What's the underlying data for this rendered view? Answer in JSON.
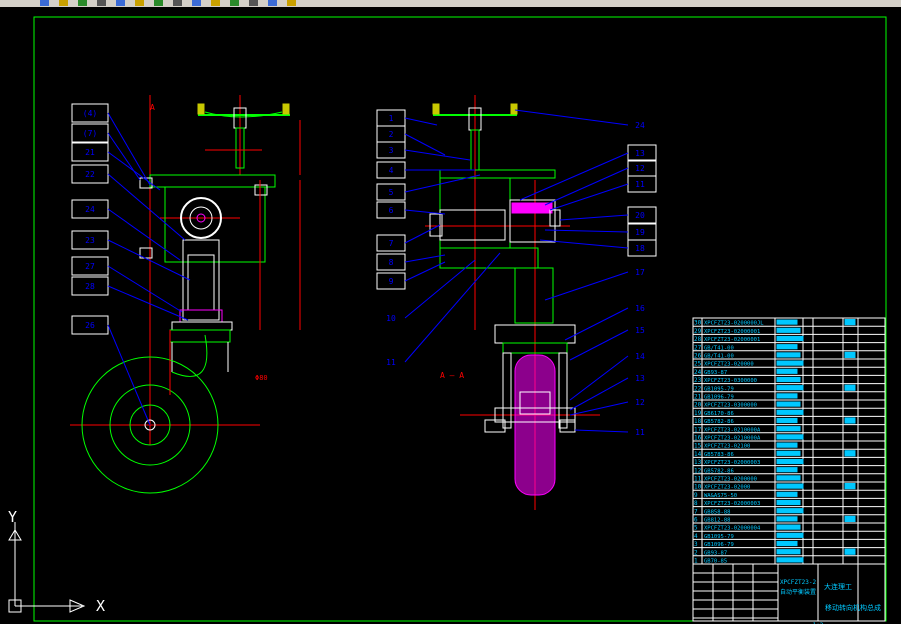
{
  "toolbar": {
    "icons": [
      "new-icon",
      "open-icon",
      "save-icon",
      "print-icon",
      "cut-icon",
      "copy-icon",
      "paste-icon",
      "undo-icon",
      "redo-icon",
      "pan-icon",
      "zoom-icon",
      "properties-icon",
      "layer-icon",
      "color-icon"
    ]
  },
  "colors": {
    "background": "#000000",
    "frame": "#00ff00",
    "outline": "#ffffff",
    "center_line": "#ff0000",
    "leader": "#0000ff",
    "dimension": "#ff0000",
    "hatch": "#ff00ff",
    "part": "#00ff00",
    "table_text": "#00c8ff",
    "gold": "#c8c800"
  },
  "ucs": {
    "y_label": "Y",
    "x_label": "X"
  },
  "left_view": {
    "label_a": "A",
    "balloons": [
      "(4)",
      "(7)",
      "21",
      "22",
      "24",
      "23",
      "27",
      "28",
      "26"
    ],
    "wheel_dims": [
      "Φ",
      "80"
    ]
  },
  "right_view": {
    "balloons_left": [
      "1",
      "2",
      "3",
      "4",
      "5",
      "6",
      "7",
      "8",
      "9",
      "10",
      "11"
    ],
    "balloons_right": [
      "24",
      "13",
      "12",
      "11",
      "20",
      "19",
      "18",
      "17",
      "16",
      "15",
      "14",
      "13",
      "12",
      "11"
    ],
    "section_label": "A — A"
  },
  "bom": {
    "rows": [
      {
        "no": "30",
        "code": "XPCFZT23-0200000JL"
      },
      {
        "no": "29",
        "code": "XPCFZT23-02000001"
      },
      {
        "no": "28",
        "code": "XPCFZT23-02000001"
      },
      {
        "no": "27",
        "code": "GB/T41-00"
      },
      {
        "no": "26",
        "code": "GB/T41-00"
      },
      {
        "no": "25",
        "code": "XPCFZT23-020000"
      },
      {
        "no": "24",
        "code": "GB93-87"
      },
      {
        "no": "23",
        "code": "XPCFZT23-0300000"
      },
      {
        "no": "22",
        "code": "GB1095-79"
      },
      {
        "no": "21",
        "code": "GB1096-79"
      },
      {
        "no": "20",
        "code": "XPCFZT23-0300000"
      },
      {
        "no": "19",
        "code": "GB6170-86"
      },
      {
        "no": "18",
        "code": "GB5782-86"
      },
      {
        "no": "17",
        "code": "XPCFZT23-0210000A"
      },
      {
        "no": "16",
        "code": "XPCFZT23-0210000A"
      },
      {
        "no": "15",
        "code": "XPCFZT23-02100"
      },
      {
        "no": "14",
        "code": "GB5783-86"
      },
      {
        "no": "13",
        "code": "XPCFZT23-02000003"
      },
      {
        "no": "12",
        "code": "GB5782-86"
      },
      {
        "no": "11",
        "code": "XPCFZT23-0200000"
      },
      {
        "no": "10",
        "code": "XPCFZT23-02000"
      },
      {
        "no": "9",
        "code": "WA&AS75-50"
      },
      {
        "no": "8",
        "code": "XPCFZT23-02000003"
      },
      {
        "no": "7",
        "code": "GB858-88"
      },
      {
        "no": "6",
        "code": "GB812-88"
      },
      {
        "no": "5",
        "code": "XPCFZT23-02000004"
      },
      {
        "no": "4",
        "code": "GB1095-79"
      },
      {
        "no": "3",
        "code": "GB1096-79"
      },
      {
        "no": "2",
        "code": "GB93-87"
      },
      {
        "no": "1",
        "code": "GB70-85"
      }
    ],
    "title_block": {
      "code_top": "XPCFZT23-2",
      "name_small": "自动平衡装置",
      "stamp": "大连理工",
      "drawing_name": "移动转向机构总成",
      "scale": "1:2",
      "drawing_no": "XPCFZT23-0200000A"
    }
  }
}
